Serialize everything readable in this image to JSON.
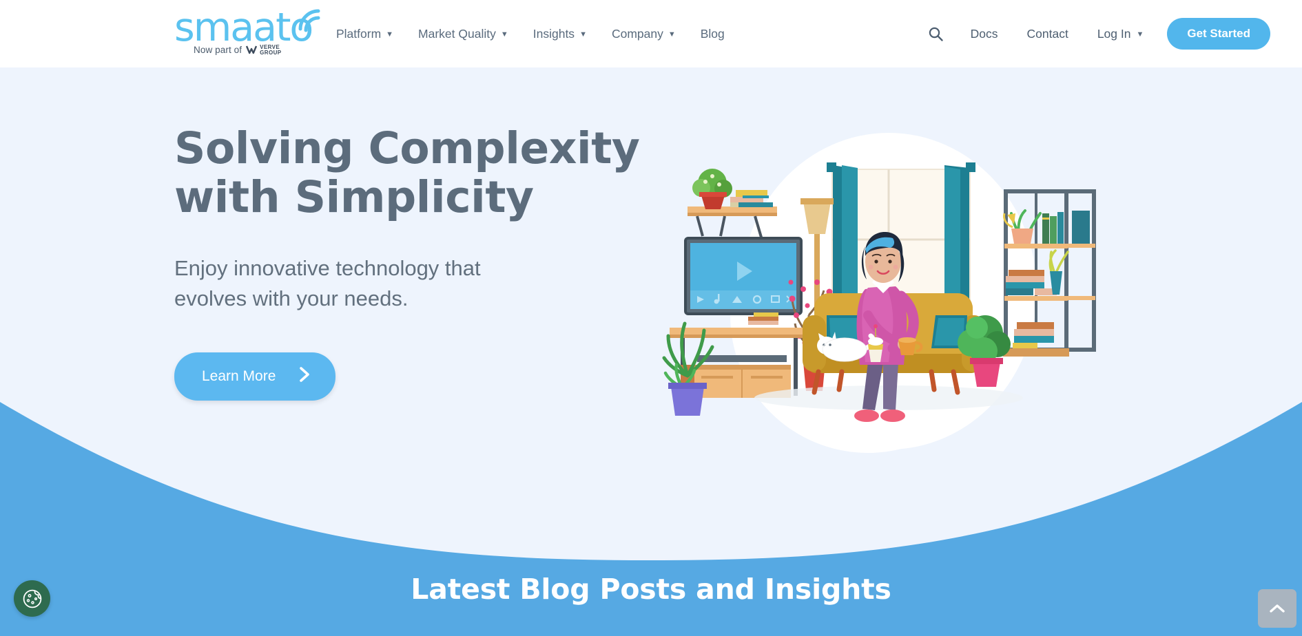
{
  "brand": {
    "logo_word": "smaato",
    "logo_tagline": "Now part of",
    "partner_line1": "VERVE",
    "partner_line2": "GROUP",
    "logo_color": "#5bc2ef",
    "accent_color": "#52b6ec",
    "hero_bg": "#eef4fd",
    "band_bg": "#56a9e3",
    "heading_color": "#5c6c7c"
  },
  "nav": {
    "items": [
      {
        "label": "Platform",
        "has_dropdown": true
      },
      {
        "label": "Market Quality",
        "has_dropdown": true
      },
      {
        "label": "Insights",
        "has_dropdown": true
      },
      {
        "label": "Company",
        "has_dropdown": true
      },
      {
        "label": "Blog",
        "has_dropdown": false
      }
    ],
    "search_icon": "search-icon",
    "links": [
      {
        "label": "Docs",
        "has_dropdown": false
      },
      {
        "label": "Contact",
        "has_dropdown": false
      },
      {
        "label": "Log In",
        "has_dropdown": true
      }
    ],
    "cta_label": "Get Started"
  },
  "hero": {
    "title_line1": "Solving Complexity",
    "title_line2": "with Simplicity",
    "subtitle_line1": "Enjoy innovative technology that",
    "subtitle_line2": "evolves with your needs.",
    "button_label": "Learn More",
    "button_icon": "chevron-right-icon",
    "illustration": "woman-on-sofa-living-room-illustration"
  },
  "blog_section": {
    "title": "Latest Blog Posts and Insights"
  },
  "floating": {
    "cookie_button": "cookie-consent-button",
    "scroll_top_button": "scroll-to-top-button"
  }
}
